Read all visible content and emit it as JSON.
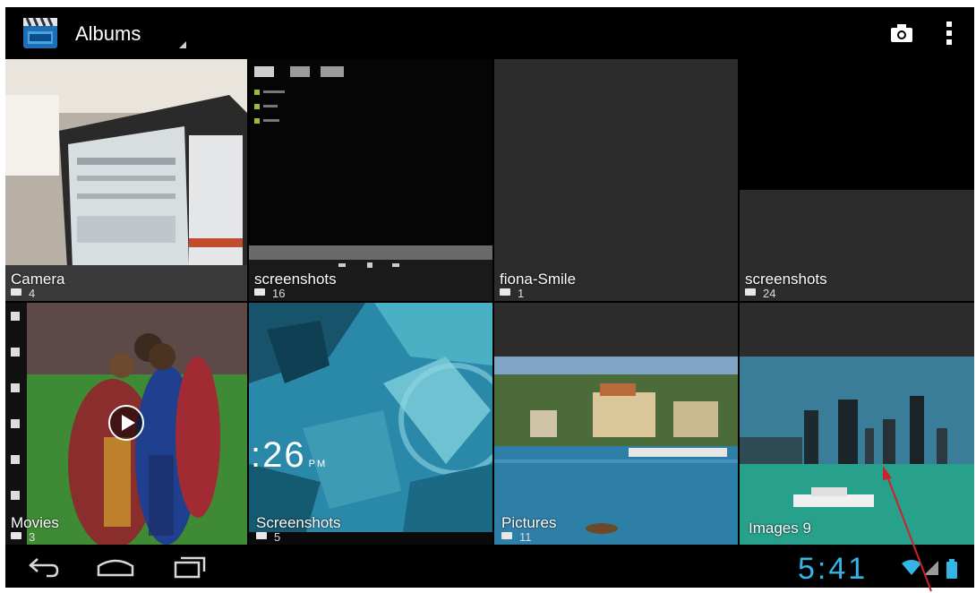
{
  "actionbar": {
    "title": "Albums",
    "icons": [
      "gallery-app-icon",
      "camera-icon",
      "overflow-menu-icon"
    ]
  },
  "albums": [
    {
      "name": "Camera",
      "count": "4"
    },
    {
      "name": "screenshots",
      "count": "16"
    },
    {
      "name": "fiona-Smile",
      "count": "1"
    },
    {
      "name": "screenshots",
      "count": "24"
    },
    {
      "name": "Movies",
      "count": "3"
    },
    {
      "name": "Screenshots",
      "count": "5"
    },
    {
      "name": "Pictures",
      "count": "11"
    },
    {
      "name": "Images 9",
      "count": ""
    }
  ],
  "thumbnail_text": {
    "lockscreen_time": "26",
    "lockscreen_ampm": "PM"
  },
  "navbar": {
    "buttons": [
      "back-icon",
      "home-icon",
      "recent-apps-icon"
    ]
  },
  "status": {
    "time": "5:41",
    "icons": [
      "wifi-icon",
      "signal-icon",
      "battery-icon"
    ]
  },
  "colors": {
    "clock": "#33b5e5",
    "annotation_arrow": "#d0202a"
  }
}
